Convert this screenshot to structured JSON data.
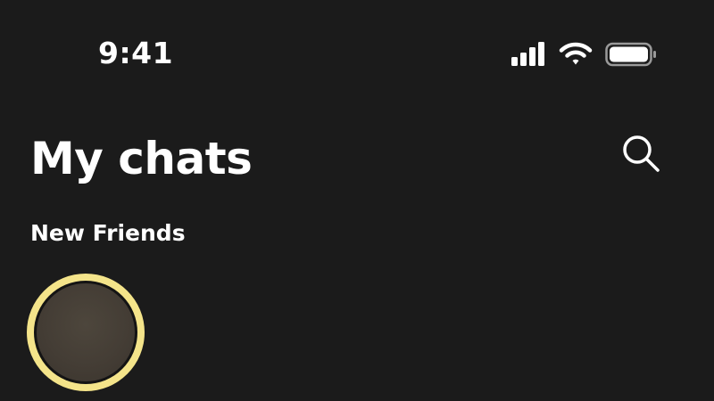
{
  "status_bar": {
    "time": "9:41",
    "icons": [
      "cellular-signal-icon",
      "wifi-icon",
      "battery-icon"
    ]
  },
  "header": {
    "title": "My chats",
    "search_icon": "search-icon"
  },
  "new_friends": {
    "title": "New Friends",
    "ring_color": "#f4e48a"
  },
  "colors": {
    "background": "#1b1b1b",
    "text": "#ffffff",
    "accent": "#f4e48a"
  }
}
